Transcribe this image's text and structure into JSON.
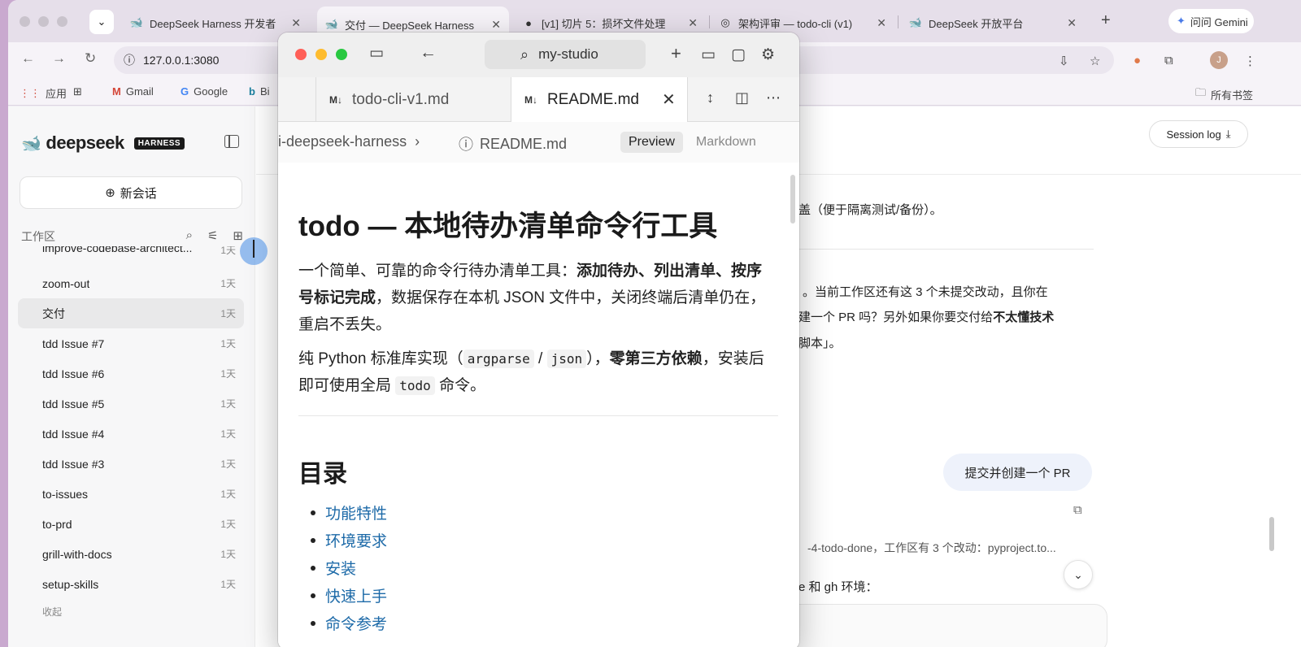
{
  "browser": {
    "tabs": [
      {
        "title": "DeepSeek Harness 开发者",
        "fav": "🐋"
      },
      {
        "title": "交付 — DeepSeek Harness",
        "fav": "🐋"
      },
      {
        "title": "[v1] 切片 5：损坏文件处理",
        "fav": "●"
      },
      {
        "title": "架构评审 — todo-cli (v1)",
        "fav": "◎"
      },
      {
        "title": "DeepSeek 开放平台",
        "fav": "🐋"
      }
    ],
    "gemini_label": "问问 Gemini",
    "url": "127.0.0.1:3080",
    "avatar_letter": "J",
    "bookmarks": {
      "apps": "应用",
      "gmail": "Gmail",
      "google": "Google",
      "bing": "Bi",
      "all": "所有书签"
    }
  },
  "sidebar": {
    "brand": "deepseek",
    "badge": "HARNESS",
    "new_chat": "新会话",
    "workspace_label": "工作区",
    "items": [
      {
        "label": "improve-codebase-architect...",
        "age": "1天"
      },
      {
        "label": "zoom-out",
        "age": "1天"
      },
      {
        "label": "交付",
        "age": "1天"
      },
      {
        "label": "tdd Issue #7",
        "age": "1天"
      },
      {
        "label": "tdd Issue #6",
        "age": "1天"
      },
      {
        "label": "tdd Issue #5",
        "age": "1天"
      },
      {
        "label": "tdd Issue #4",
        "age": "1天"
      },
      {
        "label": "tdd Issue #3",
        "age": "1天"
      },
      {
        "label": "to-issues",
        "age": "1天"
      },
      {
        "label": "to-prd",
        "age": "1天"
      },
      {
        "label": "grill-with-docs",
        "age": "1天"
      },
      {
        "label": "setup-skills",
        "age": "1天"
      }
    ],
    "collapse": "收起"
  },
  "main": {
    "session_log": "Session log",
    "line1": "盖（便于隔离测试/备份）。",
    "line2": "。当前工作区还有这 3 个未提交改动，且你在",
    "line3a": "建一个 PR 吗？另外如果你要交付给",
    "line3b": "不太懂技术",
    "line4": "脚本」。",
    "user_message": "提交并创建一个 PR",
    "status_line": "-4-todo-done，工作区有 3 个改动：pyproject.to...",
    "env_line": "e 和 gh 环境："
  },
  "studio": {
    "search": "my-studio",
    "tabs": [
      {
        "label": "todo-cli-v1.md",
        "glyph": "M↓"
      },
      {
        "label": "README.md",
        "glyph": "M↓"
      }
    ],
    "breadcrumb_path": "li-deepseek-harness",
    "breadcrumb_file": "README.md",
    "mode_preview": "Preview",
    "mode_markdown": "Markdown",
    "doc": {
      "h1": "todo — 本地待办清单命令行工具",
      "p1_a": "一个简单、可靠的命令行待办清单工具：",
      "p1_b": "添加待办、列出清单、按序号标记完成",
      "p1_c": "，数据保存在本机 JSON 文件中，关闭终端后清单仍在，重启不丢失。",
      "p2_a": "纯 Python 标准库实现（",
      "p2_code1": "argparse",
      "p2_sep": " / ",
      "p2_code2": "json",
      "p2_b": "），",
      "p2_bold": "零第三方依赖",
      "p2_c": "，安装后即可使用全局 ",
      "p2_code3": "todo",
      "p2_d": " 命令。",
      "h2": "目录",
      "toc": [
        "功能特性",
        "环境要求",
        "安装",
        "快速上手",
        "命令参考"
      ]
    }
  }
}
